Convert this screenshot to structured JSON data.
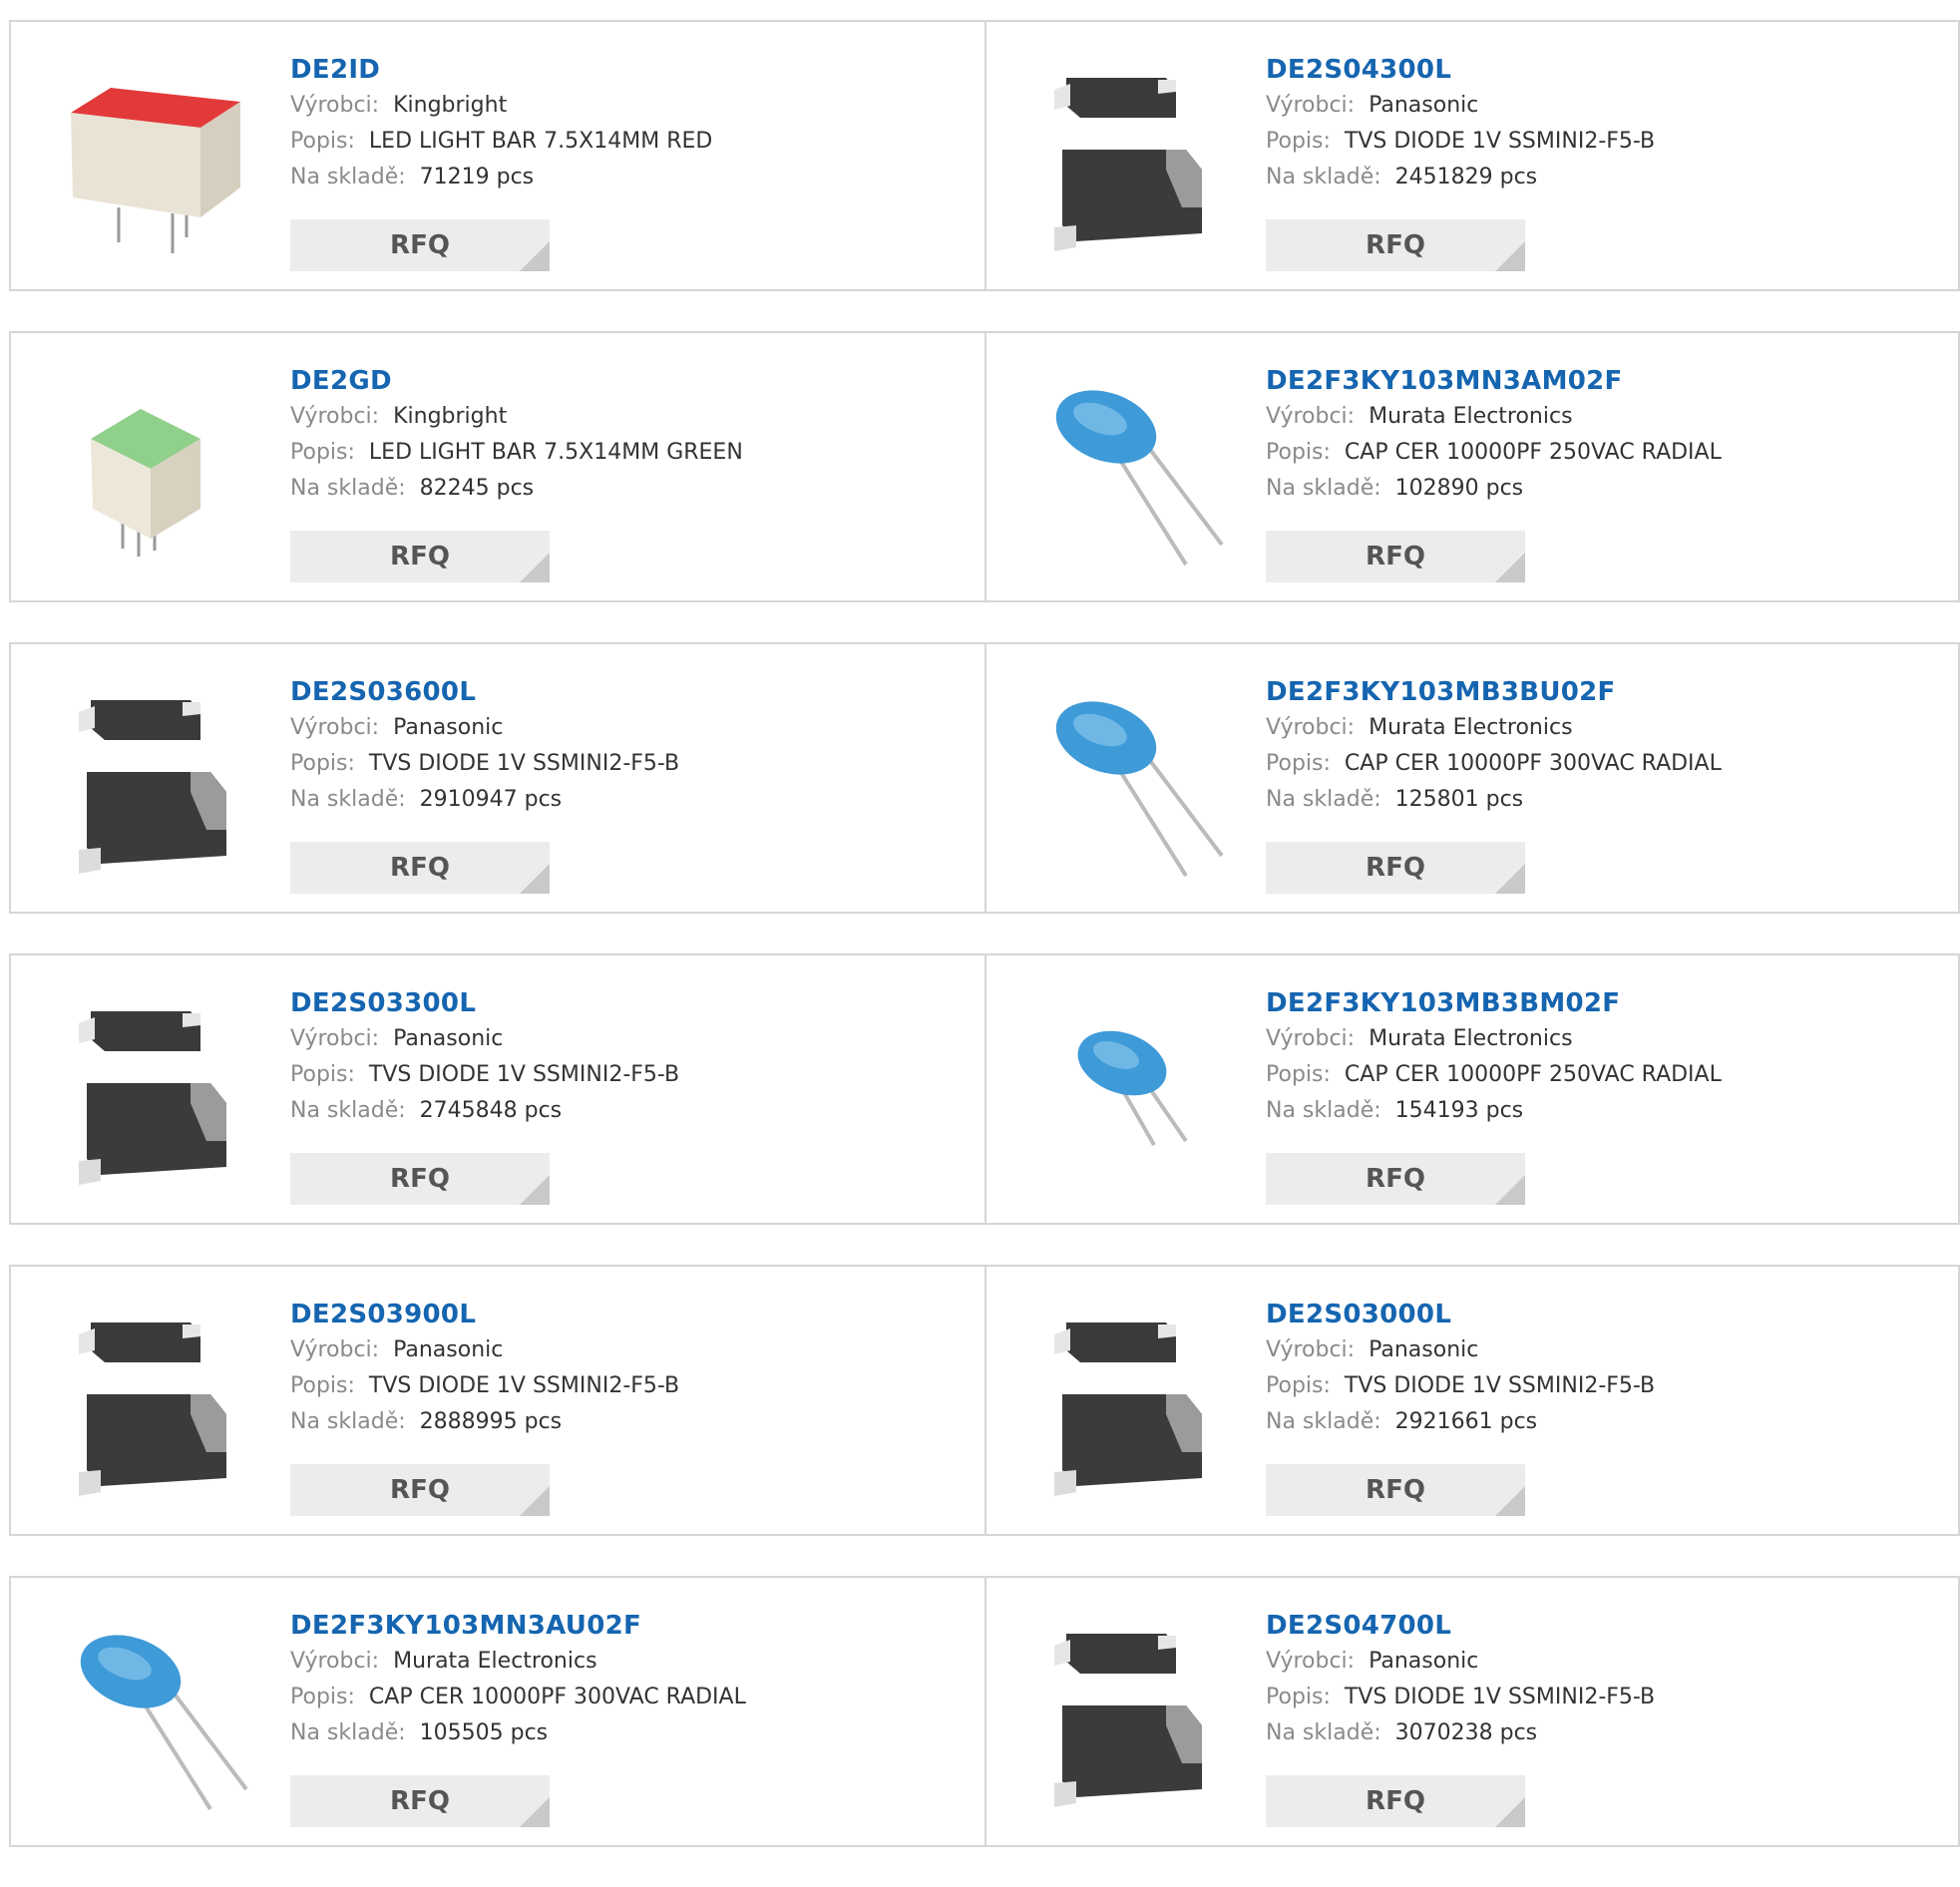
{
  "labels": {
    "manufacturer": "Výrobci:",
    "description": "Popis:",
    "stock": "Na skladě:",
    "rfq": "RFQ"
  },
  "rows": [
    [
      {
        "part": "DE2ID",
        "manufacturer": "Kingbright",
        "description": "LED LIGHT BAR 7.5X14MM RED",
        "stock": "71219 pcs",
        "image": "led-bar-red"
      },
      {
        "part": "DE2S04300L",
        "manufacturer": "Panasonic",
        "description": "TVS DIODE 1V SSMINI2-F5-B",
        "stock": "2451829 pcs",
        "image": "smd-diode"
      }
    ],
    [
      {
        "part": "DE2GD",
        "manufacturer": "Kingbright",
        "description": "LED LIGHT BAR 7.5X14MM GREEN",
        "stock": "82245 pcs",
        "image": "led-bar-green"
      },
      {
        "part": "DE2F3KY103MN3AM02F",
        "manufacturer": "Murata Electronics",
        "description": "CAP CER 10000PF 250VAC RADIAL",
        "stock": "102890 pcs",
        "image": "ceramic-capacitor"
      }
    ],
    [
      {
        "part": "DE2S03600L",
        "manufacturer": "Panasonic",
        "description": "TVS DIODE 1V SSMINI2-F5-B",
        "stock": "2910947 pcs",
        "image": "smd-diode"
      },
      {
        "part": "DE2F3KY103MB3BU02F",
        "manufacturer": "Murata Electronics",
        "description": "CAP CER 10000PF 300VAC RADIAL",
        "stock": "125801 pcs",
        "image": "ceramic-capacitor"
      }
    ],
    [
      {
        "part": "DE2S03300L",
        "manufacturer": "Panasonic",
        "description": "TVS DIODE 1V SSMINI2-F5-B",
        "stock": "2745848 pcs",
        "image": "smd-diode"
      },
      {
        "part": "DE2F3KY103MB3BM02F",
        "manufacturer": "Murata Electronics",
        "description": "CAP CER 10000PF 250VAC RADIAL",
        "stock": "154193 pcs",
        "image": "ceramic-capacitor-small"
      }
    ],
    [
      {
        "part": "DE2S03900L",
        "manufacturer": "Panasonic",
        "description": "TVS DIODE 1V SSMINI2-F5-B",
        "stock": "2888995 pcs",
        "image": "smd-diode"
      },
      {
        "part": "DE2S03000L",
        "manufacturer": "Panasonic",
        "description": "TVS DIODE 1V SSMINI2-F5-B",
        "stock": "2921661 pcs",
        "image": "smd-diode"
      }
    ],
    [
      {
        "part": "DE2F3KY103MN3AU02F",
        "manufacturer": "Murata Electronics",
        "description": "CAP CER 10000PF 300VAC RADIAL",
        "stock": "105505 pcs",
        "image": "ceramic-capacitor"
      },
      {
        "part": "DE2S04700L",
        "manufacturer": "Panasonic",
        "description": "TVS DIODE 1V SSMINI2-F5-B",
        "stock": "3070238 pcs",
        "image": "smd-diode"
      }
    ]
  ],
  "colors": {
    "link": "#1565b0",
    "label": "#8a8a8a",
    "border": "#d6d6d6",
    "button_bg": "#ececec"
  }
}
